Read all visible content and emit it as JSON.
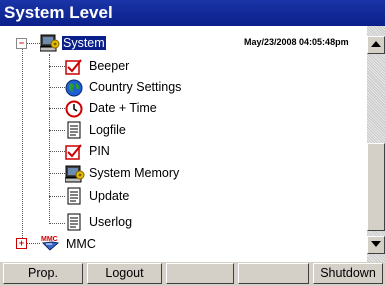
{
  "window": {
    "title": "System Level"
  },
  "timestamp": "May/23/2008 04:05:48pm",
  "tree": {
    "root": {
      "label": "System",
      "expander": "−"
    },
    "children": [
      {
        "label": "Beeper",
        "icon": "checkbox-icon"
      },
      {
        "label": "Country Settings",
        "icon": "globe-icon"
      },
      {
        "label": "Date + Time",
        "icon": "clock-icon"
      },
      {
        "label": "Logfile",
        "icon": "document-icon"
      },
      {
        "label": "PIN",
        "icon": "checkbox-icon"
      },
      {
        "label": "System Memory",
        "icon": "computer-icon"
      },
      {
        "label": "Update",
        "icon": "document-icon"
      },
      {
        "label": "Userlog",
        "icon": "document-icon"
      }
    ],
    "second_root": {
      "label": "MMC",
      "expander": "+"
    }
  },
  "buttons": {
    "prop": "Prop.",
    "logout": "Logout",
    "blank1": "",
    "blank2": "",
    "shutdown": "Shutdown"
  },
  "colors": {
    "title_bar": "#0a1f8a",
    "selection": "#0a1f8a",
    "button_face": "#d4d0c8"
  }
}
